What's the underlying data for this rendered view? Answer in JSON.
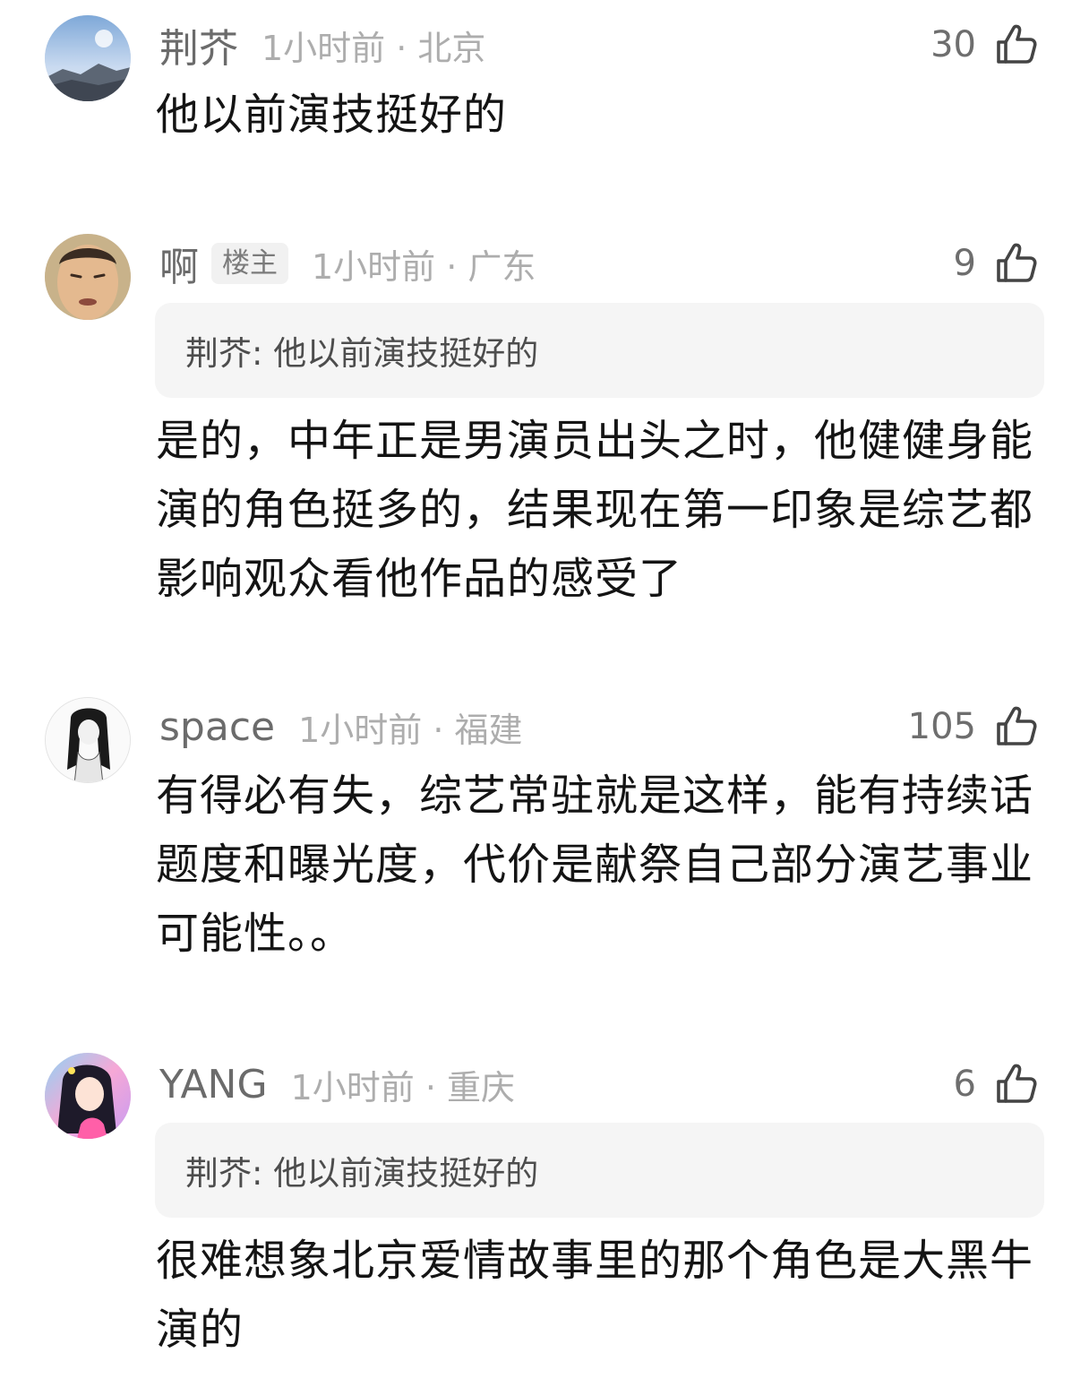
{
  "colors": {
    "background": "#ffffff",
    "username": "#6b6b6b",
    "meta": "#adadad",
    "text": "#141414",
    "quote_bg": "#f5f5f5"
  },
  "comments": [
    {
      "username": "荆芥",
      "op_badge": "",
      "time_location": "1小时前 · 北京",
      "likes": "30",
      "like_icon": "thumbs-up-icon",
      "quote": "",
      "text": "他以前演技挺好的"
    },
    {
      "username": "啊",
      "op_badge": "楼主",
      "time_location": "1小时前 · 广东",
      "likes": "9",
      "like_icon": "thumbs-up-icon",
      "quote": "荆芥: 他以前演技挺好的",
      "text": "是的，中年正是男演员出头之时，他健健身能演的角色挺多的，结果现在第一印象是综艺都影响观众看他作品的感受了"
    },
    {
      "username": "space",
      "op_badge": "",
      "time_location": "1小时前 · 福建",
      "likes": "105",
      "like_icon": "thumbs-up-icon",
      "quote": "",
      "text": "有得必有失，综艺常驻就是这样，能有持续话题度和曝光度，代价是献祭自己部分演艺事业可能性。。"
    },
    {
      "username": "YANG",
      "op_badge": "",
      "time_location": "1小时前 · 重庆",
      "likes": "6",
      "like_icon": "thumbs-up-icon",
      "quote": "荆芥: 他以前演技挺好的",
      "text": "很难想象北京爱情故事里的那个角色是大黑牛演的"
    }
  ]
}
